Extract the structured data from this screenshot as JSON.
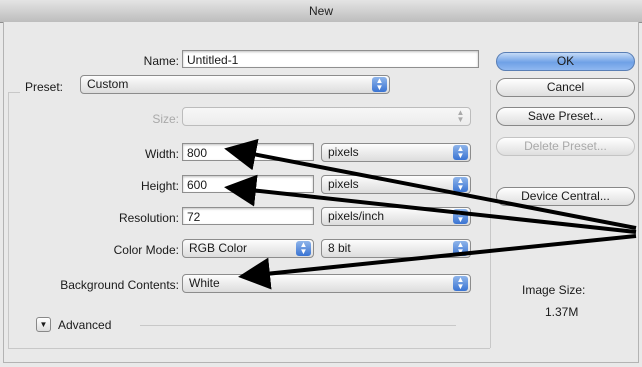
{
  "window": {
    "title": "New"
  },
  "form": {
    "name_label": "Name:",
    "name_value": "Untitled-1",
    "preset_label": "Preset:",
    "preset_value": "Custom",
    "size_label": "Size:",
    "size_value": "",
    "width_label": "Width:",
    "width_value": "800",
    "width_unit": "pixels",
    "height_label": "Height:",
    "height_value": "600",
    "height_unit": "pixels",
    "resolution_label": "Resolution:",
    "resolution_value": "72",
    "resolution_unit": "pixels/inch",
    "colormode_label": "Color Mode:",
    "colormode_value": "RGB Color",
    "bitdepth_value": "8 bit",
    "background_label": "Background Contents:",
    "background_value": "White",
    "advanced_label": "Advanced"
  },
  "buttons": {
    "ok": "OK",
    "cancel": "Cancel",
    "save_preset": "Save Preset...",
    "delete_preset": "Delete Preset...",
    "device_central": "Device Central..."
  },
  "info": {
    "image_size_label": "Image Size:",
    "image_size_value": "1.37M"
  },
  "icons": {
    "select_arrows": "up-down-arrows-icon",
    "disclosure": "disclosure-triangle-icon",
    "annotation": "annotation-arrow-icon"
  },
  "colors": {
    "default_button": "#6fa1e6",
    "select_arrow": "#3a74d3",
    "annotation_arrow": "#000000"
  }
}
